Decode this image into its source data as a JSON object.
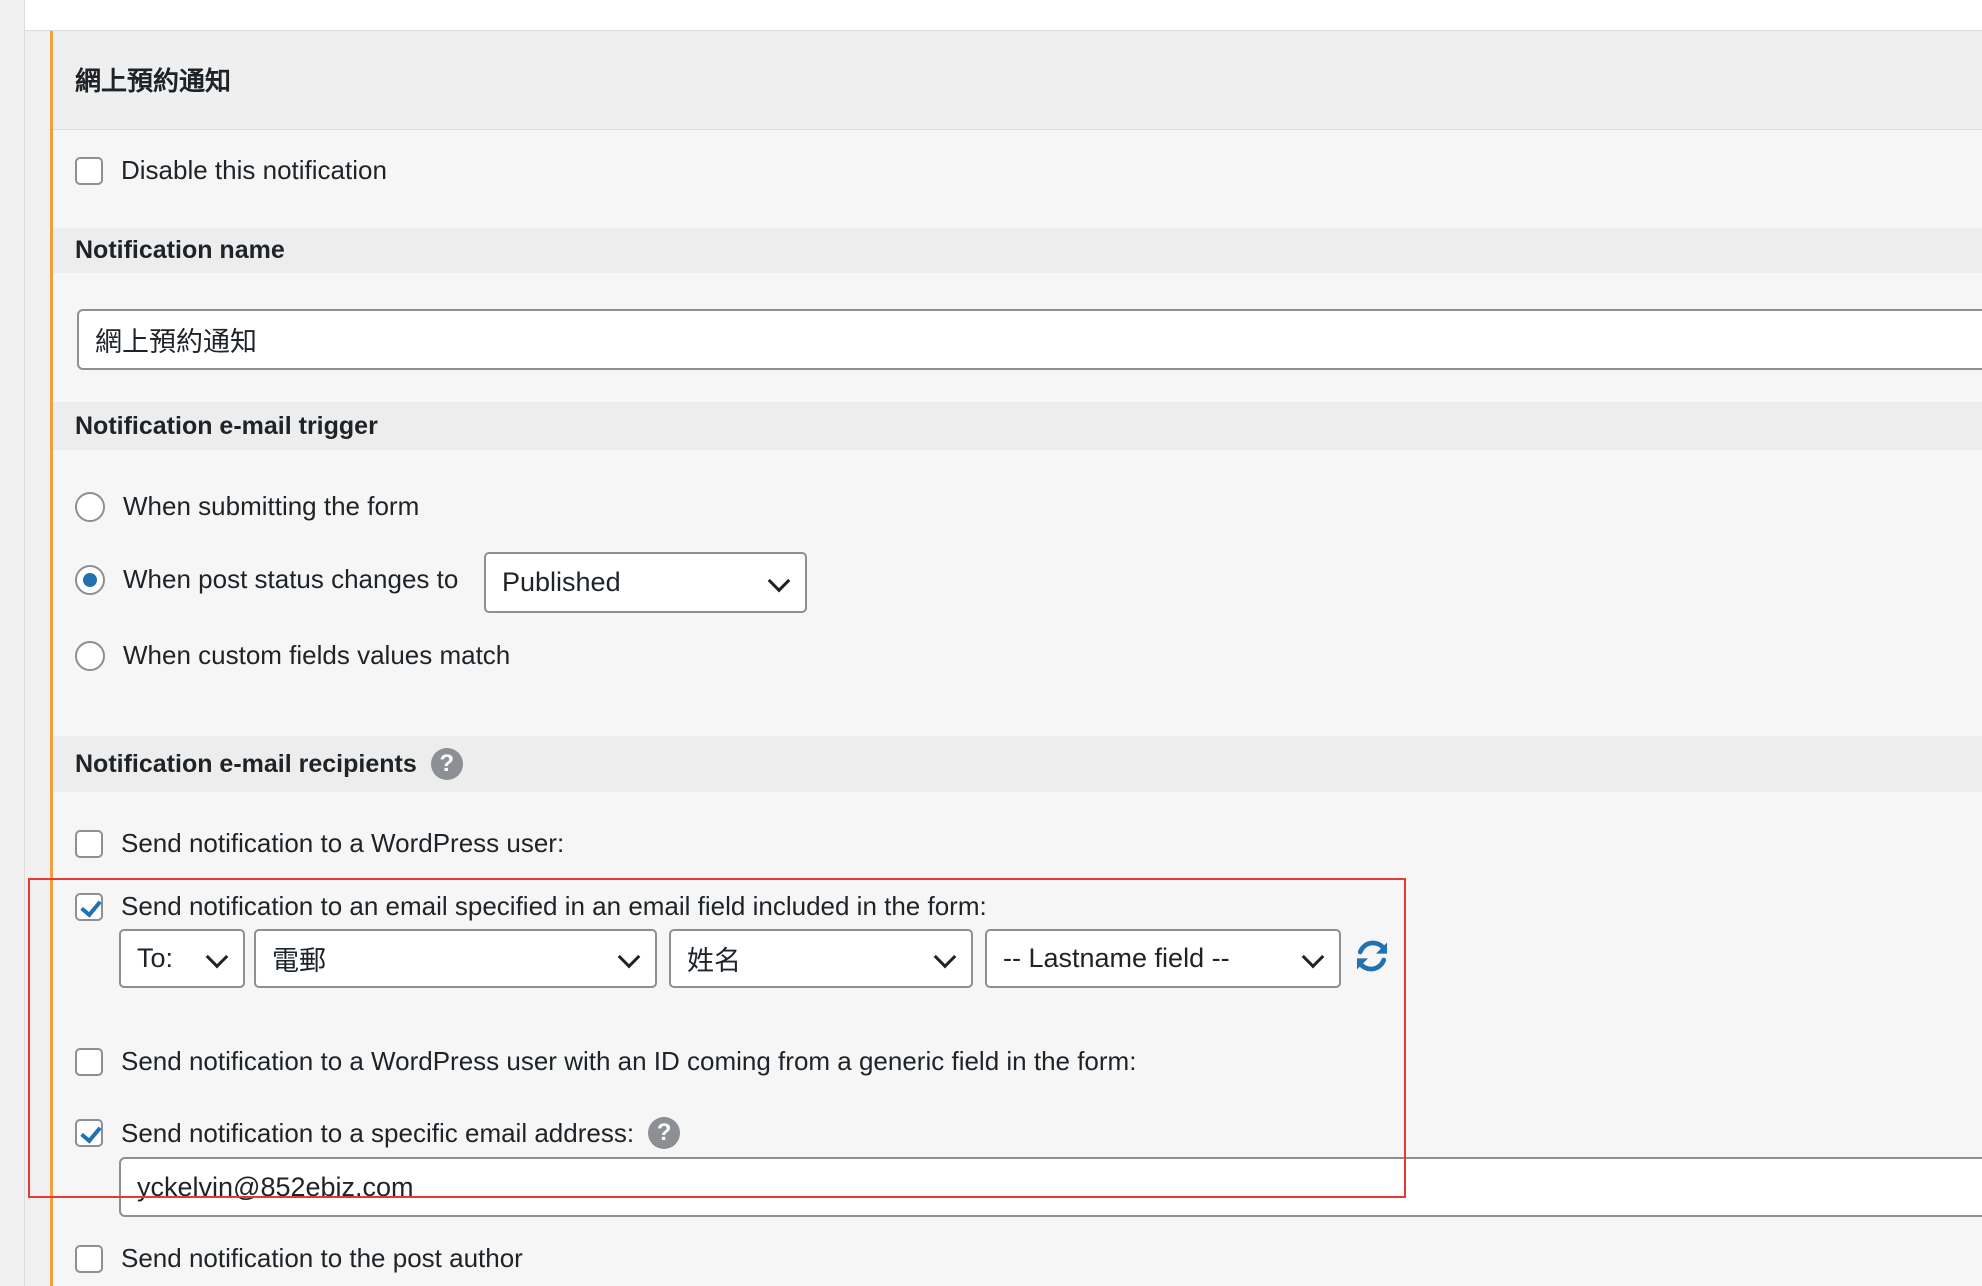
{
  "panel": {
    "title": "網上預約通知",
    "disable_label": "Disable this notification"
  },
  "notification_name": {
    "heading": "Notification name",
    "value": "網上預約通知"
  },
  "trigger": {
    "heading": "Notification e-mail trigger",
    "options": [
      "When submitting the form",
      "When post status changes to",
      "When custom fields values match"
    ],
    "status_select": "Published"
  },
  "recipients": {
    "heading": "Notification e-mail recipients",
    "help_glyph": "?",
    "wp_user_label": "Send notification to a WordPress user:",
    "email_field_label": "Send notification to an email specified in an email field included in the form:",
    "to_select": "To:",
    "email_field_select": "電郵",
    "name_field_select": "姓名",
    "lastname_field_select": "-- Lastname field --",
    "generic_id_label": "Send notification to a WordPress user with an ID coming from a generic field in the form:",
    "specific_email_label": "Send notification to a specific email address:",
    "specific_email_value": "yckelvin@852ebiz.com",
    "post_author_label": "Send notification to the post author"
  },
  "colors": {
    "accent_blue": "#2271b1",
    "panel_border_orange": "#f0a040",
    "highlight_red": "#e53935"
  },
  "icons": [
    "help-icon",
    "refresh-icon",
    "chevron-down-icon",
    "checkmark-icon"
  ]
}
